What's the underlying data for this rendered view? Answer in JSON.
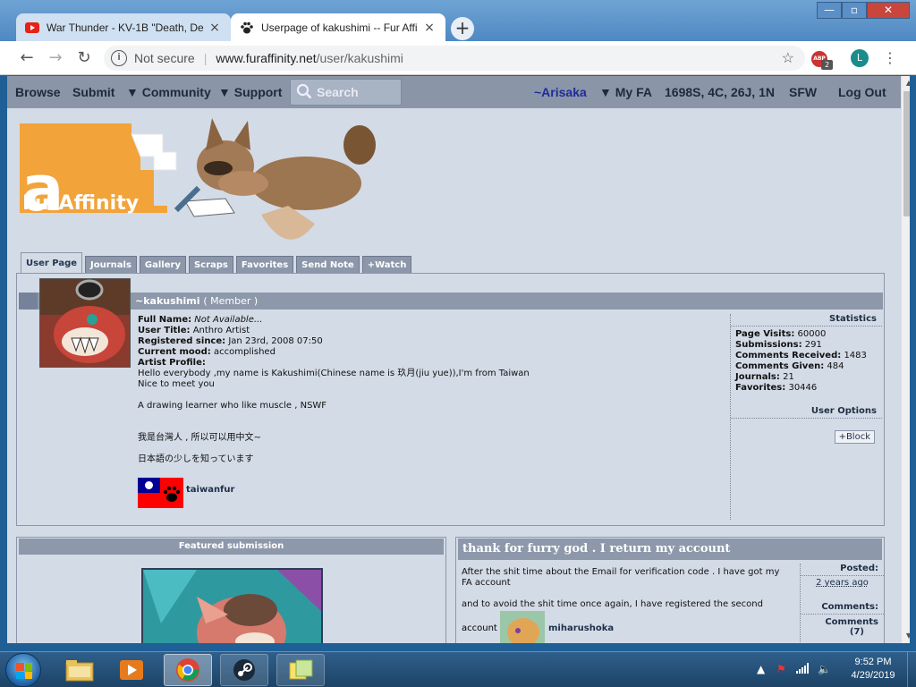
{
  "browser": {
    "tabs": [
      {
        "title": "War Thunder - KV-1B \"Death, De",
        "close": "×"
      },
      {
        "title": "Userpage of kakushimi -- Fur Affi",
        "close": "×"
      }
    ],
    "new_tab": "+",
    "url": {
      "security": "Not secure",
      "domain": "www.furaffinity.net",
      "path": "/user/kakushimi"
    },
    "profile_initial": "L",
    "extension_badge": "2",
    "extension_label": "ABP"
  },
  "fa_nav": {
    "browse": "Browse",
    "submit": "Submit",
    "community": "▼ Community",
    "support": "▼ Support",
    "search_placeholder": "Search",
    "user": "~Arisaka",
    "my_fa": "▼ My FA",
    "counts": "1698S, 4C, 26J, 1N",
    "sfw": "SFW",
    "logout": "Log Out"
  },
  "logo_text": "FurAffinity",
  "profile_tabs": [
    "User Page",
    "Journals",
    "Gallery",
    "Scraps",
    "Favorites",
    "Send Note",
    "+Watch"
  ],
  "profile": {
    "username": "~kakushimi",
    "level": "( Member )",
    "full_name_label": "Full Name:",
    "full_name": "Not Available...",
    "user_title_label": "User Title:",
    "user_title": "Anthro Artist",
    "registered_label": "Registered since:",
    "registered": "Jan 23rd, 2008 07:50",
    "mood_label": "Current mood:",
    "mood": "accomplished",
    "artist_profile_label": "Artist Profile:",
    "bio_line1": "Hello everybody ,my name is Kakushimi(Chinese name is 玖月(jiu yue)),I'm from Taiwan",
    "bio_line2": "Nice to meet you",
    "bio_line3": "A drawing learner who like muscle , NSWF",
    "bio_line4": "我是台灣人 ,  所以可以用中文~",
    "bio_line5": "日本語の少しを知っています",
    "badge_name": "taiwanfur"
  },
  "statistics": {
    "heading": "Statistics",
    "items": [
      {
        "label": "Page Visits:",
        "value": "60000"
      },
      {
        "label": "Submissions:",
        "value": "291"
      },
      {
        "label": "Comments Received:",
        "value": "1483"
      },
      {
        "label": "Comments Given:",
        "value": "484"
      },
      {
        "label": "Journals:",
        "value": "21"
      },
      {
        "label": "Favorites:",
        "value": "30446"
      }
    ],
    "options_heading": "User Options",
    "block_button": "+Block"
  },
  "featured": {
    "heading": "Featured submission"
  },
  "journal": {
    "title": "thank for furry god . I return my account",
    "p1": "After the shit time about the Email for verification code . I have got my FA account",
    "p2": "and to avoid the shit time once again, I have registered the second",
    "account_label": "account",
    "account_name": "miharushoka",
    "posted_label": "Posted:",
    "posted_ago": "2 years ago",
    "comments_label": "Comments:",
    "comments_link": "Comments",
    "comments_count": "(7)"
  },
  "taskbar": {
    "time": "9:52 PM",
    "date": "4/29/2019"
  }
}
